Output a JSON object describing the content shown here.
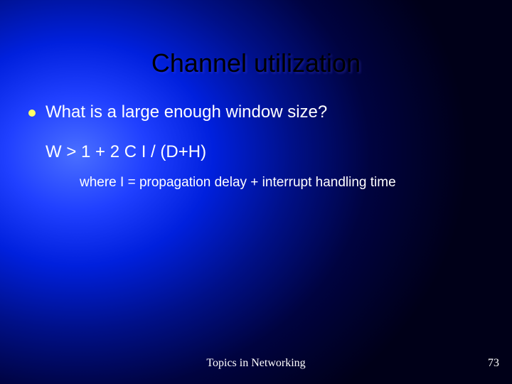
{
  "slide": {
    "title": "Channel utilization",
    "bullet": "What is a large enough window size?",
    "formula": "W > 1 + 2 C I / (D+H)",
    "note": "where I = propagation delay + interrupt handling time"
  },
  "footer": {
    "topic": "Topics in Networking",
    "page": "73"
  }
}
